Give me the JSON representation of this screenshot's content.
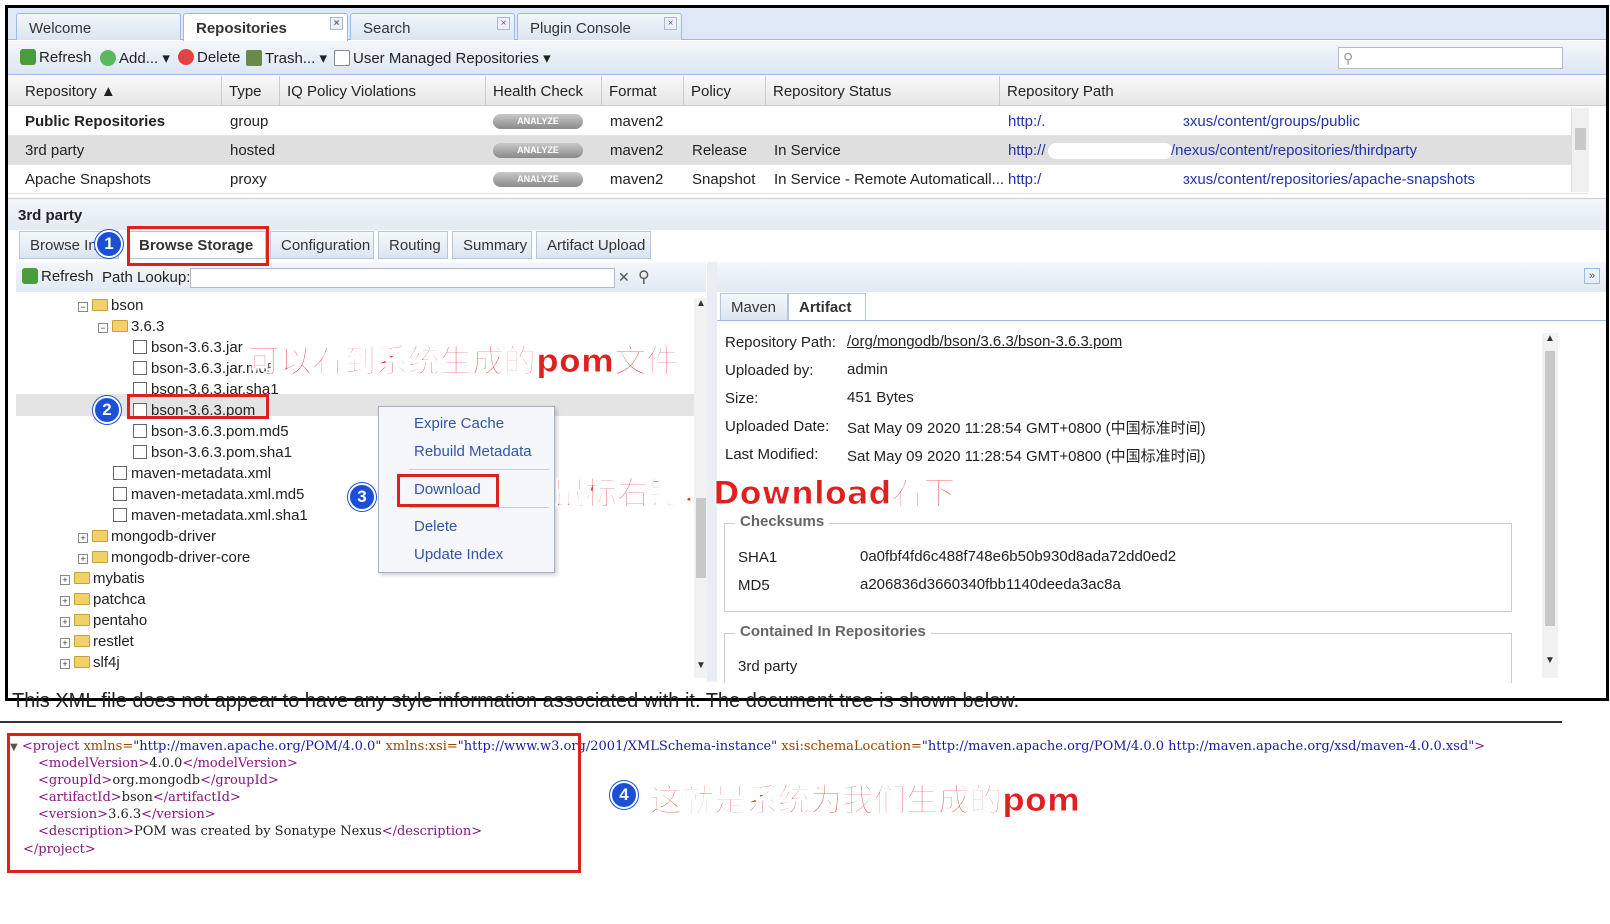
{
  "tabs": [
    {
      "label": "Welcome",
      "x": false
    },
    {
      "label": "Repositories",
      "x": true
    },
    {
      "label": "Search",
      "x": true
    },
    {
      "label": "Plugin Console",
      "x": true
    }
  ],
  "toolbar": {
    "refresh": "Refresh",
    "add": "Add...",
    "delete": "Delete",
    "trash": "Trash...",
    "user_managed": "User Managed Repositories"
  },
  "grid": {
    "headers": [
      "Repository ▲",
      "Type",
      "IQ Policy Violations",
      "Health Check",
      "Format",
      "Policy",
      "Repository Status",
      "Repository Path"
    ],
    "analyze_label": "ANALYZE",
    "rows": [
      {
        "repository": "Public Repositories",
        "type": "group",
        "format": "maven2",
        "policy": "",
        "status": "",
        "path_start": "http:/.",
        "path_end": "ɜxus/content/groups/public"
      },
      {
        "repository": "3rd party",
        "type": "hosted",
        "format": "maven2",
        "policy": "Release",
        "status": "In Service",
        "path_start": "http://",
        "path_end": "/nexus/content/repositories/thirdparty"
      },
      {
        "repository": "Apache Snapshots",
        "type": "proxy",
        "format": "maven2",
        "policy": "Snapshot",
        "status": "In Service - Remote Automaticall...",
        "path_start": "http:/",
        "path_end": "ɜxus/content/repositories/apache-snapshots"
      }
    ]
  },
  "panel_title": "3rd party",
  "subtabs": [
    "Browse In",
    "Browse Storage",
    "Configuration",
    "Routing",
    "Summary",
    "Artifact Upload"
  ],
  "browse": {
    "refresh": "Refresh",
    "path_lookup": "Path Lookup:",
    "tree": [
      {
        "label": "bson",
        "type": "folder",
        "toggle": "⊟"
      },
      {
        "label": "3.6.3",
        "type": "folder",
        "toggle": "⊟"
      },
      {
        "label": "bson-3.6.3.jar",
        "type": "file"
      },
      {
        "label": "bson-3.6.3.jar.md5",
        "type": "file"
      },
      {
        "label": "bson-3.6.3.jar.sha1",
        "type": "file"
      },
      {
        "label": "bson-3.6.3.pom",
        "type": "file"
      },
      {
        "label": "bson-3.6.3.pom.md5",
        "type": "file"
      },
      {
        "label": "bson-3.6.3.pom.sha1",
        "type": "file"
      },
      {
        "label": "maven-metadata.xml",
        "type": "file"
      },
      {
        "label": "maven-metadata.xml.md5",
        "type": "file"
      },
      {
        "label": "maven-metadata.xml.sha1",
        "type": "file"
      },
      {
        "label": "mongodb-driver",
        "type": "folder",
        "toggle": "⊞"
      },
      {
        "label": "mongodb-driver-core",
        "type": "folder",
        "toggle": "⊞"
      },
      {
        "label": "mybatis",
        "type": "folder",
        "toggle": "⊞"
      },
      {
        "label": "patchca",
        "type": "folder",
        "toggle": "⊞"
      },
      {
        "label": "pentaho",
        "type": "folder",
        "toggle": "⊞"
      },
      {
        "label": "restlet",
        "type": "folder",
        "toggle": "⊞"
      },
      {
        "label": "slf4j",
        "type": "folder",
        "toggle": "⊞"
      }
    ]
  },
  "context_menu": [
    "Expire Cache",
    "Rebuild Metadata",
    "Download",
    "Delete",
    "Update Index"
  ],
  "artifact": {
    "tabs": [
      "Maven",
      "Artifact"
    ],
    "repository_path_label": "Repository Path:",
    "repository_path": "/org/mongodb/bson/3.6.3/bson-3.6.3.pom",
    "uploaded_by_label": "Uploaded by:",
    "uploaded_by": "admin",
    "size_label": "Size:",
    "size": "451 Bytes",
    "uploaded_date_label": "Uploaded Date:",
    "uploaded_date": "Sat May 09 2020 11:28:54 GMT+0800 (中国标准时间)",
    "last_modified_label": "Last Modified:",
    "last_modified": "Sat May 09 2020 11:28:54 GMT+0800 (中国标准时间)",
    "checksums_title": "Checksums",
    "sha1_label": "SHA1",
    "sha1": "0a0fbf4fd6c488f748e6b50b930d8ada72dd0ed2",
    "md5_label": "MD5",
    "md5": "a206836d3660340fbb1140deeda3ac8a",
    "contained_title": "Contained In Repositories",
    "contained_first": "3rd party"
  },
  "annotations": {
    "n1": "1",
    "n2": "2",
    "n3": "3",
    "n4": "4",
    "pom_note": "可以看到系统生成的pom文件",
    "download_note": "鼠标右键，Download看下",
    "generated_note": "这就是系统为我们生成的pom"
  },
  "xml": {
    "note": "This XML file does not appear to have any style information associated with it. The document tree is shown below.",
    "project_open_tag": "<project",
    "xmlns_attr": " xmlns=",
    "xmlns_val": "\"http://maven.apache.org/POM/4.0.0\"",
    "xsi_attr": " xmlns:xsi=",
    "xsi_val": "\"http://www.w3.org/2001/XMLSchema-instance\"",
    "schema_attr": " xsi:schemaLocation=",
    "schema_val": "\"http://maven.apache.org/POM/4.0.0 http://maven.apache.org/xsd/maven-4.0.0.xsd\"",
    "project_open_end": ">",
    "lines": [
      {
        "open": "<modelVersion>",
        "text": "4.0.0",
        "close": "</modelVersion>"
      },
      {
        "open": "<groupId>",
        "text": "org.mongodb",
        "close": "</groupId>"
      },
      {
        "open": "<artifactId>",
        "text": "bson",
        "close": "</artifactId>"
      },
      {
        "open": "<version>",
        "text": "3.6.3",
        "close": "</version>"
      },
      {
        "open": "<description>",
        "text": "POM was created by Sonatype Nexus",
        "close": "</description>"
      }
    ],
    "project_close": "</project>"
  }
}
